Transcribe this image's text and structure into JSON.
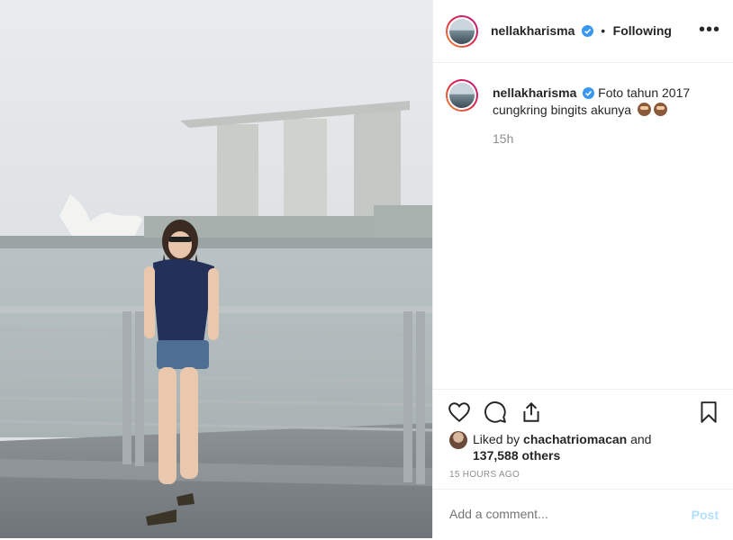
{
  "post": {
    "username": "nellakharisma",
    "follow_dot": "•",
    "follow_status": "Following",
    "more_icon": "•••",
    "caption_text": "Foto tahun 2017 cungkring bingits akunya",
    "caption_emojis": [
      "see-no-evil-monkey",
      "see-no-evil-monkey"
    ],
    "relative_time": "15h",
    "liked_by_prefix": "Liked by",
    "liked_by_user": "chachatriomacan",
    "liked_by_and": "and",
    "liked_by_others": "137,588 others",
    "timestamp": "15 HOURS AGO",
    "comment_placeholder": "Add a comment...",
    "post_label": "Post"
  },
  "colors": {
    "verified": "#3897f0",
    "story_ring": "#dc2743",
    "post_disabled": "#b2dffc",
    "muted": "#8e8e8e"
  },
  "icons": [
    "heart-icon",
    "comment-icon",
    "share-icon",
    "bookmark-icon",
    "verified-icon",
    "more-icon"
  ]
}
